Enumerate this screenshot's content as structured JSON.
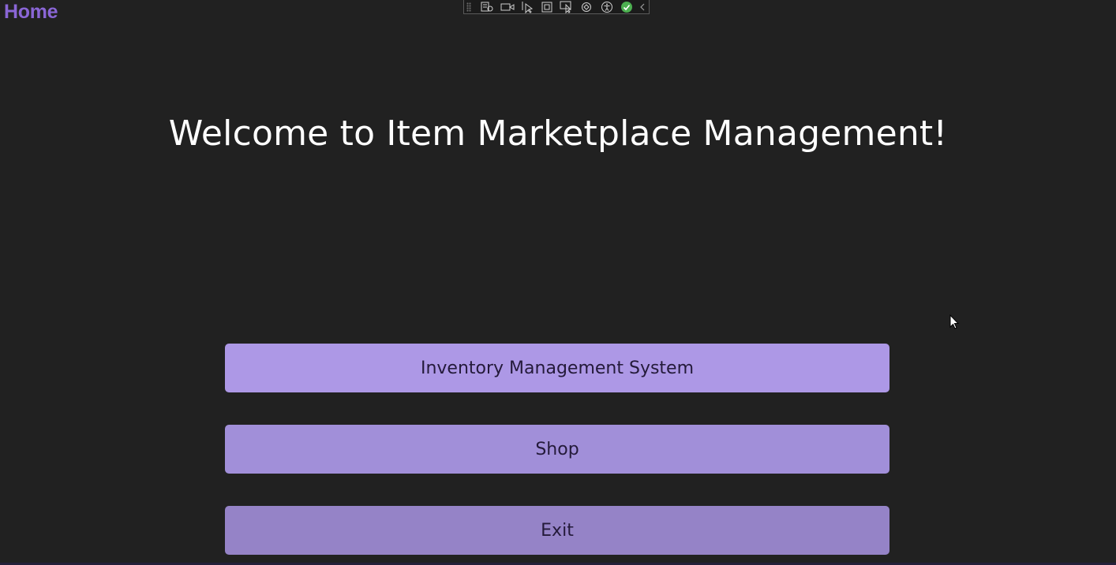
{
  "window": {
    "title": "Home"
  },
  "toolbar": {
    "tools": [
      "live-visual-tree-icon",
      "record-icon",
      "select-element-icon",
      "display-layout-adorners-icon",
      "track-focus-icon",
      "hot-reload-icon",
      "accessibility-checker-icon",
      "binding-ok-icon",
      "collapse-toolbar-icon"
    ],
    "status_color": "#4caf50"
  },
  "main": {
    "welcome_text": "Welcome to Item Marketplace Management!",
    "buttons": [
      {
        "label": "Inventory Management System"
      },
      {
        "label": "Shop"
      },
      {
        "label": "Exit"
      }
    ]
  },
  "colors": {
    "background": "#212121",
    "title_accent": "#8a66d6",
    "button_top": "#ad98e6",
    "button_mid": "#a18fd9",
    "button_bottom": "#9583c7"
  }
}
